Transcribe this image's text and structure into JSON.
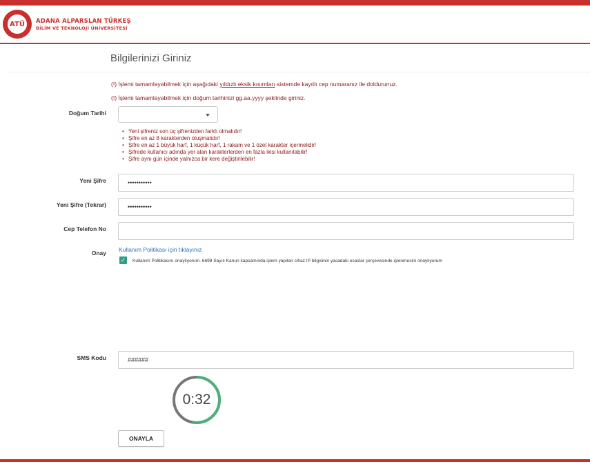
{
  "header": {
    "logo_abbrev": "ATÜ",
    "university_line1": "ADANA ALPARSLAN TÜRKEŞ",
    "university_line2": "BİLİM VE TEKNOLOJİ ÜNİVERSİTESİ"
  },
  "page_title": "Bilgilerinizi Giriniz",
  "warnings": {
    "w1_prefix": "(!) İşlemi tamamlayabilmek için aşağıdaki ",
    "w1_link": "yıldızlı eksik kısımları",
    "w1_suffix": " sistemde kayıtlı cep numaranız ile doldurunuz.",
    "w2": "(!) İşlemi tamamlayabilmek için doğum tarihinizi gg.aa.yyyy şeklinde giriniz."
  },
  "form": {
    "birth_date_label": "Doğum Tarihi",
    "password_rules": [
      "Yeni şifreniz son üç şifrenizden farklı olmalıdır!",
      "Şifre en az 8 karakterden oluşmalıdır!",
      "Şifre en az 1 büyük harf, 1 küçük harf, 1 rakam ve 1 özel karakter içermelidir!",
      "Şifrede kullanıcı adında yer alan karakterlerden en fazla ikisi kullanılabilir!",
      "Şifre aynı gün içinde yalnızca bir kere değiştirilebilir!"
    ],
    "new_password_label": "Yeni Şifre",
    "new_password_value": "•••••••••••",
    "new_password_repeat_label": "Yeni Şifre (Tekrar)",
    "new_password_repeat_value": "•••••••••••",
    "phone_label": "Cep Telefon No",
    "consent_label": "Onay",
    "policy_link": "Kullanım Politikası için tıklayınız",
    "consent_checked": true,
    "consent_text": "Kullanım Politikasını onaylıyorum. 6698 Sayılı Kanun kapsamında işlem yapılan cihaz IP bilgisinin yasadaki esaslar çerçevesinde işlenmesini onaylıyorum",
    "sms_label": "SMS Kodu",
    "sms_placeholder": "######"
  },
  "timer": {
    "display": "0:32",
    "progress_fraction": 0.53,
    "progress_color": "#4caf7d",
    "track_color": "#777777"
  },
  "actions": {
    "confirm_label": "ONAYLA"
  },
  "colors": {
    "brand_red": "#c9302c",
    "warning_text": "#8b1a1a",
    "link": "#2a6ebb",
    "checkbox": "#2e9e82"
  }
}
